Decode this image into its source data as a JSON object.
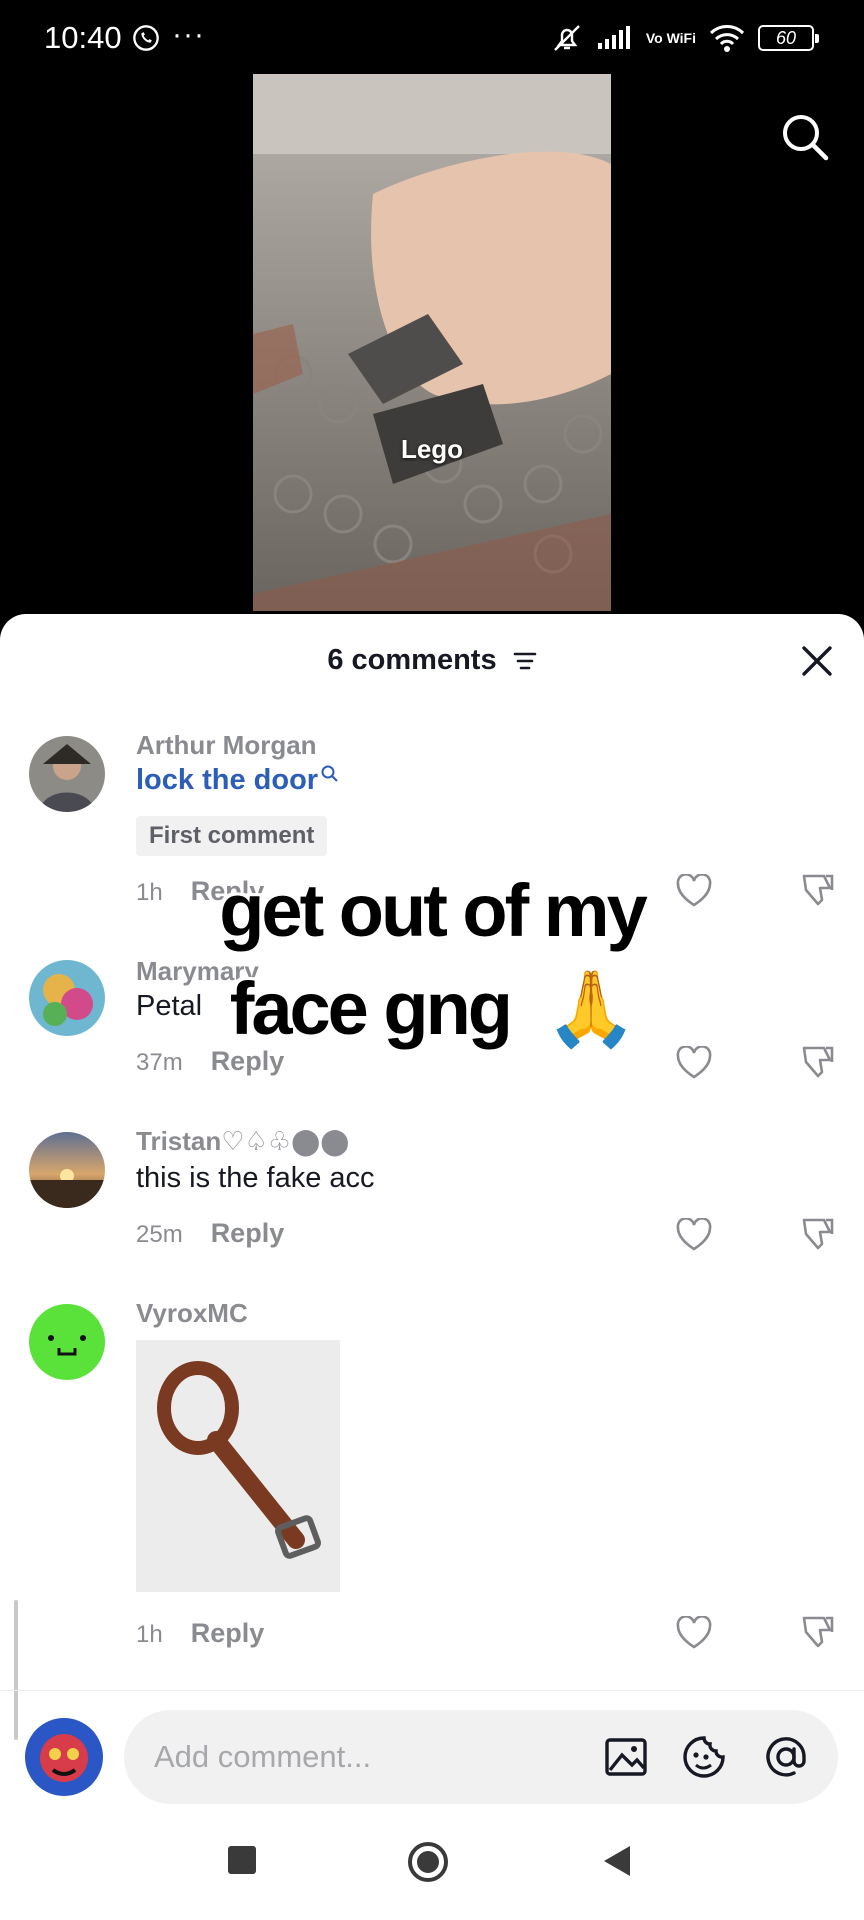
{
  "status_bar": {
    "time": "10:40",
    "battery": "60",
    "network_label": "Vo WiFi"
  },
  "video": {
    "caption": "Lego"
  },
  "sheet": {
    "title": "6 comments"
  },
  "comments": [
    {
      "username": "Arthur Morgan",
      "text": "lock the door",
      "badge": "First comment",
      "time": "1h",
      "reply": "Reply"
    },
    {
      "username": "Marymary",
      "text": "Petal",
      "time": "37m",
      "reply": "Reply"
    },
    {
      "username": "Tristan♡♤♧⬤⬤",
      "text": "this is the fake acc",
      "time": "25m",
      "reply": "Reply"
    },
    {
      "username": "VyroxMC",
      "time": "1h",
      "reply": "Reply"
    }
  ],
  "overlay": {
    "line1": "get out of my",
    "line2": "face gng",
    "emoji": "🙏"
  },
  "composer": {
    "placeholder": "Add comment..."
  },
  "colors": {
    "accent_link": "#2b5db9",
    "muted": "#8a8b91",
    "text": "#161823"
  }
}
